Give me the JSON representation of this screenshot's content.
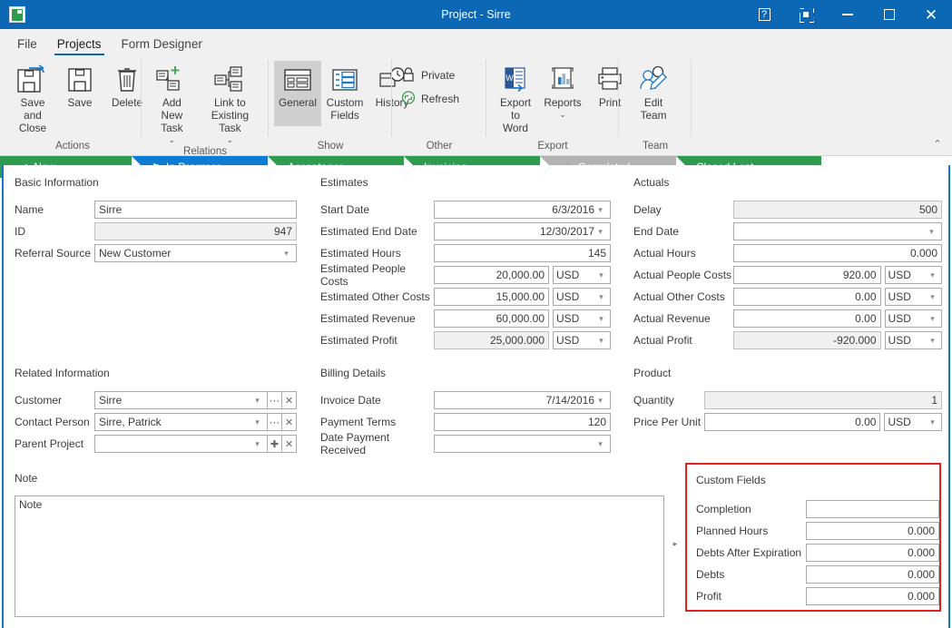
{
  "window": {
    "title": "Project - Sirre",
    "app_icon": "project-book-icon",
    "buttons": [
      {
        "name": "help-button",
        "icon": "help-icon"
      },
      {
        "name": "restore-down-button",
        "icon": "restore-down-icon"
      },
      {
        "name": "minimize-button",
        "icon": "minimize-icon"
      },
      {
        "name": "maximize-button",
        "icon": "maximize-icon"
      },
      {
        "name": "close-button",
        "icon": "close-icon"
      }
    ]
  },
  "ribbon": {
    "tabs": [
      {
        "label": "File",
        "active": false
      },
      {
        "label": "Projects",
        "active": true
      },
      {
        "label": "Form Designer",
        "active": false
      }
    ],
    "collapse_glyph": "⌃",
    "groups": [
      {
        "title": "Actions",
        "buttons": [
          {
            "label": "Save and\nClose",
            "icon": "save-and-close-icon"
          },
          {
            "label": "Save",
            "icon": "save-icon"
          },
          {
            "label": "Delete",
            "icon": "delete-icon"
          }
        ]
      },
      {
        "title": "Relations",
        "buttons": [
          {
            "label": "Add New\nTask",
            "icon": "add-new-task-icon",
            "dropdown": true
          },
          {
            "label": "Link to\nExisting Task",
            "icon": "link-existing-task-icon",
            "dropdown": true
          }
        ]
      },
      {
        "title": "Show",
        "buttons": [
          {
            "label": "General",
            "icon": "general-icon",
            "selected": true
          },
          {
            "label": "Custom\nFields",
            "icon": "custom-fields-icon"
          },
          {
            "label": "History",
            "icon": "history-icon"
          }
        ]
      },
      {
        "title": "Other",
        "small_buttons": [
          {
            "label": "Private",
            "icon": "lock-icon"
          },
          {
            "label": "Refresh",
            "icon": "refresh-icon"
          }
        ]
      },
      {
        "title": "Export",
        "buttons": [
          {
            "label": "Export\nto Word",
            "icon": "word-export-icon"
          },
          {
            "label": "Reports",
            "icon": "reports-chart-icon",
            "dropdown": true
          },
          {
            "label": "Print",
            "icon": "printer-icon"
          }
        ]
      },
      {
        "title": "Team",
        "buttons": [
          {
            "label": "Edit Team",
            "icon": "edit-team-icon"
          }
        ]
      }
    ]
  },
  "stages": [
    {
      "label": "New",
      "state": "done",
      "icon": "check-icon"
    },
    {
      "label": "In Progress",
      "state": "active",
      "icon": "flag-icon"
    },
    {
      "label": "Acceptance",
      "state": "done",
      "icon": ""
    },
    {
      "label": "Invoicing",
      "state": "done",
      "icon": ""
    },
    {
      "label": "Completed",
      "state": "locked",
      "icon": "lock-icon"
    },
    {
      "label": "Closed Lost",
      "state": "done",
      "icon": ""
    }
  ],
  "colors": {
    "title_bar": "#0c68b4",
    "stage_done": "#2e9b4e",
    "stage_active": "#0c7cd5",
    "stage_locked": "#b3b3b3",
    "accent_border": "#1477c8",
    "highlight_box": "#e32020"
  },
  "form": {
    "basic_information": {
      "title": "Basic Information",
      "fields": [
        {
          "label": "Name",
          "value": "Sirre",
          "type": "text",
          "align": "left"
        },
        {
          "label": "ID",
          "value": "947",
          "type": "readonly",
          "align": "right"
        },
        {
          "label": "Referral Source",
          "value": "New Customer",
          "type": "dropdown",
          "align": "left"
        }
      ]
    },
    "estimates": {
      "title": "Estimates",
      "fields": [
        {
          "label": "Start Date",
          "value": "6/3/2016",
          "type": "date",
          "align": "right"
        },
        {
          "label": "Estimated End Date",
          "value": "12/30/2017",
          "type": "date",
          "align": "right"
        },
        {
          "label": "Estimated Hours",
          "value": "145",
          "type": "text",
          "align": "right"
        },
        {
          "label": "Estimated People Costs",
          "value": "20,000.00",
          "type": "currency",
          "align": "right",
          "currency": "USD"
        },
        {
          "label": "Estimated Other Costs",
          "value": "15,000.00",
          "type": "currency",
          "align": "right",
          "currency": "USD"
        },
        {
          "label": "Estimated Revenue",
          "value": "60,000.00",
          "type": "currency",
          "align": "right",
          "currency": "USD"
        },
        {
          "label": "Estimated Profit",
          "value": "25,000.000",
          "type": "currency-readonly",
          "align": "right",
          "currency": "USD"
        }
      ]
    },
    "actuals": {
      "title": "Actuals",
      "fields": [
        {
          "label": "Delay",
          "value": "500",
          "type": "readonly",
          "align": "right"
        },
        {
          "label": "End Date",
          "value": "",
          "type": "date",
          "align": "right"
        },
        {
          "label": "Actual Hours",
          "value": "0.000",
          "type": "text",
          "align": "right"
        },
        {
          "label": "Actual People Costs",
          "value": "920.00",
          "type": "currency",
          "align": "right",
          "currency": "USD"
        },
        {
          "label": "Actual Other Costs",
          "value": "0.00",
          "type": "currency",
          "align": "right",
          "currency": "USD"
        },
        {
          "label": "Actual Revenue",
          "value": "0.00",
          "type": "currency",
          "align": "right",
          "currency": "USD"
        },
        {
          "label": "Actual Profit",
          "value": "-920.000",
          "type": "currency-readonly",
          "align": "right",
          "currency": "USD"
        }
      ]
    },
    "related_information": {
      "title": "Related Information",
      "fields": [
        {
          "label": "Customer",
          "value": "Sirre",
          "type": "lookup",
          "buttons": [
            "ellipsis-button",
            "clear-button"
          ]
        },
        {
          "label": "Contact Person",
          "value": "Sirre, Patrick",
          "type": "lookup",
          "buttons": [
            "ellipsis-button",
            "clear-button"
          ]
        },
        {
          "label": "Parent Project",
          "value": "",
          "type": "lookup",
          "buttons": [
            "add-button",
            "clear-button"
          ]
        }
      ]
    },
    "billing_details": {
      "title": "Billing Details",
      "fields": [
        {
          "label": "Invoice Date",
          "value": "7/14/2016",
          "type": "date",
          "align": "right"
        },
        {
          "label": "Payment Terms",
          "value": "120",
          "type": "text",
          "align": "right"
        },
        {
          "label": "Date Payment Received",
          "value": "",
          "type": "date",
          "align": "right"
        }
      ]
    },
    "product": {
      "title": "Product",
      "fields": [
        {
          "label": "Quantity",
          "value": "1",
          "type": "readonly",
          "align": "right"
        },
        {
          "label": "Price Per Unit",
          "value": "0.00",
          "type": "currency",
          "align": "right",
          "currency": "USD"
        }
      ]
    },
    "note": {
      "title": "Note",
      "value": "Note"
    },
    "custom_fields": {
      "title": "Custom Fields",
      "expander_glyph": "▸",
      "fields": [
        {
          "label": "Completion",
          "value": "",
          "align": "right"
        },
        {
          "label": "Planned Hours",
          "value": "0.000",
          "align": "right"
        },
        {
          "label": "Debts After Expiration",
          "value": "0.000",
          "align": "right"
        },
        {
          "label": "Debts",
          "value": "0.000",
          "align": "right"
        },
        {
          "label": "Profit",
          "value": "0.000",
          "align": "right"
        }
      ]
    }
  }
}
